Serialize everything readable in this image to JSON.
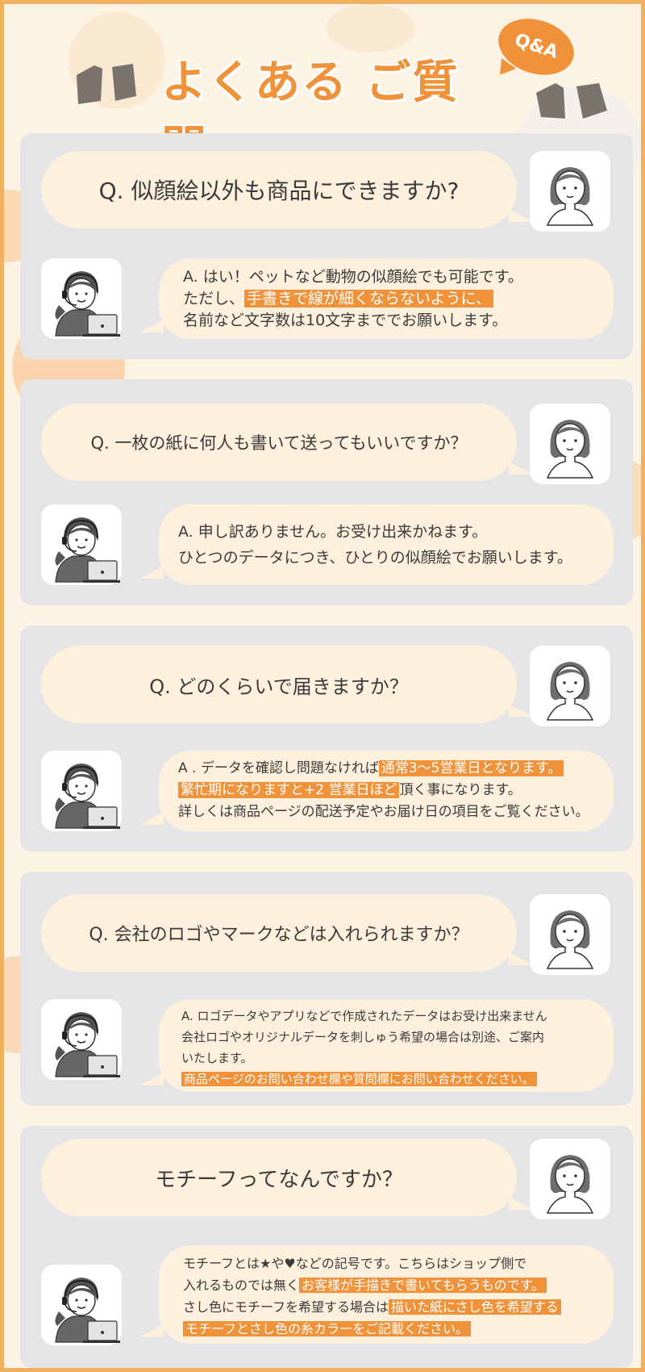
{
  "header": {
    "title": "よくある ご質問",
    "badge": "Q&A"
  },
  "colors": {
    "accent": "#f0923a",
    "border": "#f0b05e",
    "card": "#e5e5e7",
    "bubble": "#fdf1de"
  },
  "faq": [
    {
      "question": "Q. 似顔絵以外も商品にできますか?",
      "answer": {
        "l1": "A. はい！ペットなど動物の似顔絵でも可能です。",
        "l2a": "ただし、",
        "l2b": "手書きで線が細くならないように、",
        "l3": "名前など文字数は10文字まででお願いします。"
      }
    },
    {
      "question": "Q. 一枚の紙に何人も書いて送ってもいいですか？",
      "answer": {
        "l1": "A. 申し訳ありません。お受け出来かねます。",
        "l2": "ひとつのデータにつき、ひとりの似顔絵でお願いします。"
      }
    },
    {
      "question": "Q. どのくらいで届きますか？",
      "answer": {
        "l1a": "A . データを確認し問題なければ",
        "l1b": "通常3～5営業日となります。",
        "l2a": "繁忙期になりますと+2 営業日ほど",
        "l2b": "頂く事になります。",
        "l3": "詳しくは商品ページの配送予定やお届け日の項目をご覧ください。"
      }
    },
    {
      "question": "Q. 会社のロゴやマークなどは入れられますか？",
      "answer": {
        "l1": "A. ロゴデータやアプリなどで作成されたデータはお受け出来ません",
        "l2": "会社ロゴやオリジナルデータを刺しゅう希望の場合は別途、ご案内",
        "l3": "いたします。",
        "l4": "商品ページのお問い合わせ欄や質問欄にお問い合わせください。"
      }
    },
    {
      "question": "モチーフってなんですか？",
      "answer": {
        "l1": "モチーフとは★や♥などの記号です。こちらはショップ側で",
        "l2a": "入れるものでは無く",
        "l2b": "お客様が手描きで書いてもらうものです。",
        "l3a": "さし色にモチーフを希望する場合は",
        "l3b": "描いた紙にさし色を希望する",
        "l4": "モチーフとさし色の糸カラーをご記載ください。"
      }
    }
  ]
}
